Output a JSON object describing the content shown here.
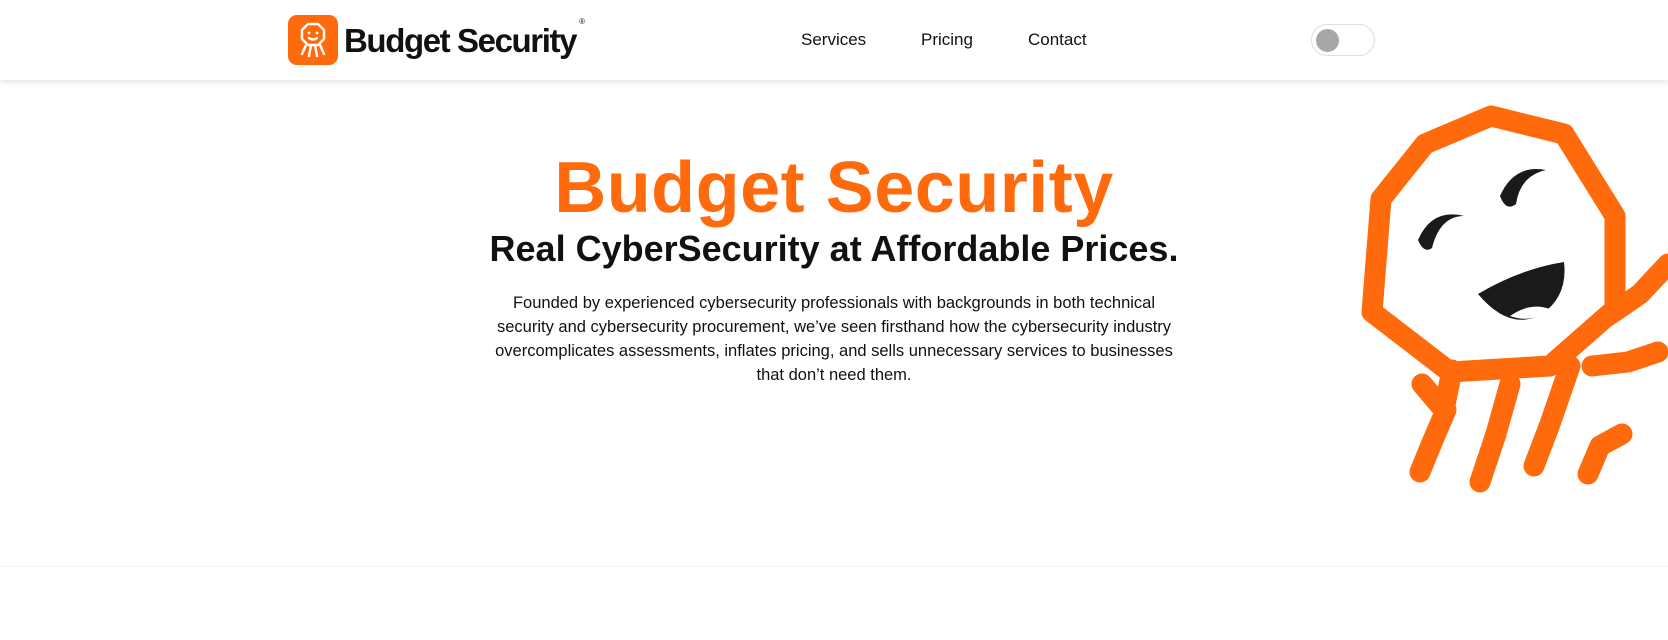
{
  "header": {
    "brand": {
      "name": "Budget Security",
      "registered_mark": "®",
      "logo_icon": "octopus-mascot-icon"
    },
    "nav": [
      {
        "label": "Services"
      },
      {
        "label": "Pricing"
      },
      {
        "label": "Contact"
      }
    ],
    "theme_toggle": {
      "state": "off"
    }
  },
  "hero": {
    "title": "Budget Security",
    "subtitle": "Real CyberSecurity at Affordable Prices.",
    "description": "Founded by experienced cybersecurity professionals with backgrounds in both technical security and cybersecurity procurement, we’ve seen firsthand how the cybersecurity industry overcomplicates assessments, inflates pricing, and sells unnecessary services to businesses that don’t need them.",
    "mascot": "octopus-mascot-illustration"
  },
  "colors": {
    "brand_orange": "#ff6a0c",
    "text": "#111111",
    "toggle_knob": "#a9a6a9"
  }
}
